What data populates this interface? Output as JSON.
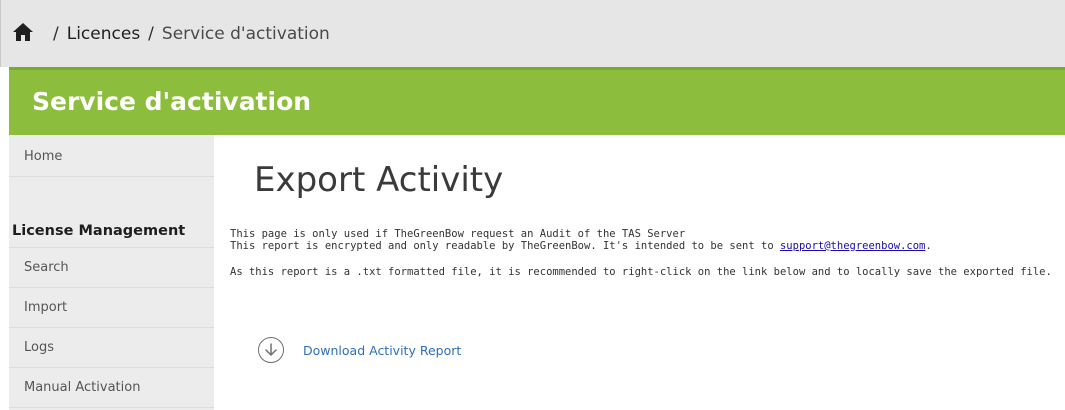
{
  "breadcrumb": {
    "separator": "/",
    "items": [
      "Licences",
      "Service d'activation"
    ]
  },
  "header": {
    "title": "Service d'activation"
  },
  "sidebar": {
    "home": "Home",
    "section_heading": "License Management",
    "items": [
      "Search",
      "Import",
      "Logs",
      "Manual Activation"
    ]
  },
  "main": {
    "title": "Export Activity",
    "line1": "This page is only used if TheGreenBow request an Audit of the TAS Server",
    "line2_prefix": "This report is encrypted and only readable by TheGreenBow. It's intended to be sent to ",
    "email": "support@thegreenbow.com",
    "line2_suffix": ".",
    "line3": "As this report is a .txt formatted file, it is recommended to right-click on the link below and to locally save the exported file.",
    "download_label": "Download Activity Report"
  },
  "colors": {
    "header_green": "#8dbd3c",
    "link_blue": "#2f6fba",
    "sidebar_bg": "#ececec",
    "breadcrumb_bg": "#e6e6e6"
  }
}
